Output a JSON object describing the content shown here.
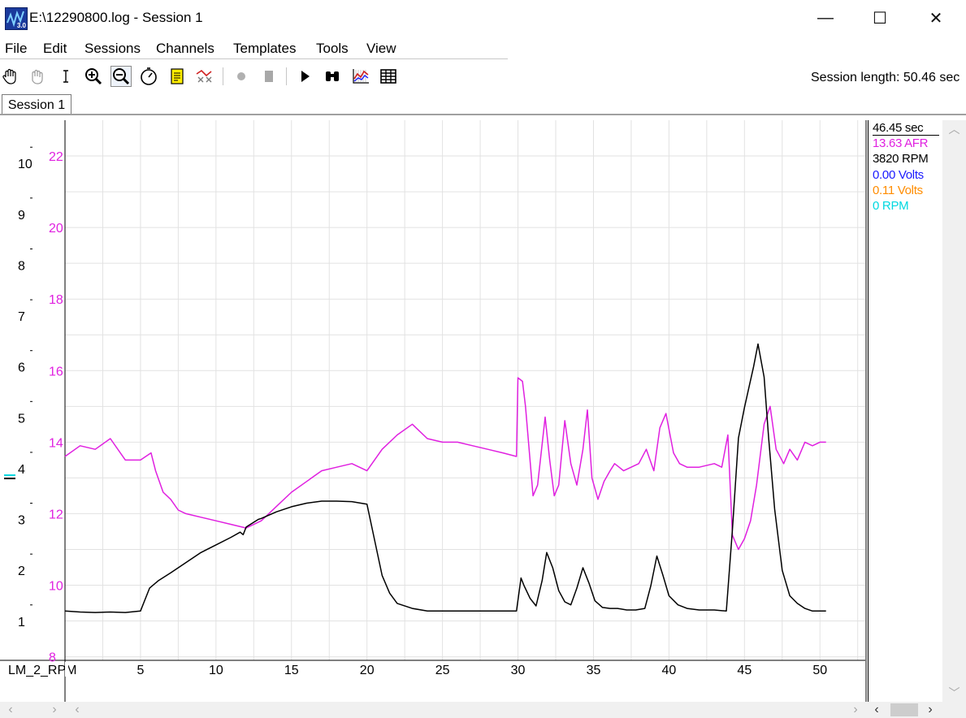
{
  "window": {
    "title": "E:\\12290800.log - Session 1",
    "icon_label": "3.0",
    "controls": {
      "minimize": "—",
      "maximize": "☐",
      "close": "✕"
    }
  },
  "menu": [
    "File",
    "Edit",
    "Sessions",
    "Channels",
    "Templates",
    "Tools",
    "View"
  ],
  "toolbar": {
    "tools": [
      "hand-icon",
      "grab-icon",
      "text-cursor-icon",
      "zoom-in-icon",
      "zoom-out-icon",
      "stopwatch-icon",
      "notes-icon",
      "zoom-fit-icon",
      "record-icon",
      "stop-icon",
      "play-icon",
      "binoculars-icon",
      "chart-icon",
      "table-icon"
    ],
    "session_length": "Session length:  50.46 sec"
  },
  "tabs": [
    "Session 1"
  ],
  "readout": {
    "time": "46.45 sec",
    "values": [
      {
        "text": "13.63 AFR",
        "color": "#e020e0"
      },
      {
        "text": "3820 RPM",
        "color": "#000000"
      },
      {
        "text": "0.00 Volts",
        "color": "#1a1aff"
      },
      {
        "text": "0.11 Volts",
        "color": "#ff8c00"
      },
      {
        "text": "0 RPM",
        "color": "#00d8e0"
      }
    ]
  },
  "chart_data": {
    "type": "line",
    "xlabel": "LM_2_RPM",
    "xlim": [
      0,
      53
    ],
    "x_ticks": [
      "5",
      "10",
      "15",
      "20",
      "25",
      "30",
      "35",
      "40",
      "45",
      "50"
    ],
    "left_axis": {
      "ticks": [
        "1",
        "2",
        "3",
        "4",
        "5",
        "6",
        "7",
        "8",
        "9",
        "10"
      ],
      "ylim": [
        0.23,
        10.85
      ],
      "color": "#000000"
    },
    "afr_axis": {
      "ticks": [
        "8",
        "10",
        "12",
        "14",
        "16",
        "18",
        "20",
        "22"
      ],
      "ylim": [
        7.9,
        23.0
      ],
      "color": "#e020e0"
    },
    "grid": true,
    "series": [
      {
        "color": "#e020e0",
        "axis": "afr",
        "x": [
          0,
          1,
          2,
          3,
          4,
          5,
          5.7,
          6,
          6.5,
          7,
          7.5,
          8,
          9,
          10,
          11,
          12,
          13,
          14,
          15,
          16,
          17,
          18,
          19,
          20,
          21,
          22,
          23,
          24,
          25,
          26,
          27,
          28,
          29,
          29.9,
          30,
          30.3,
          30.5,
          31,
          31.3,
          31.8,
          32.1,
          32.4,
          32.7,
          33.1,
          33.5,
          33.9,
          34.3,
          34.6,
          34.9,
          35.3,
          35.7,
          36.1,
          36.4,
          37,
          38,
          38.5,
          39,
          39.4,
          39.8,
          40.3,
          40.7,
          41.2,
          42,
          43,
          43.5,
          43.9,
          44.2,
          44.6,
          45,
          45.4,
          45.8,
          46.3,
          46.7,
          47.1,
          47.6,
          48,
          48.5,
          49,
          49.5,
          50,
          50.4
        ],
        "y": [
          13.6,
          13.9,
          13.8,
          14.1,
          13.5,
          13.5,
          13.7,
          13.2,
          12.6,
          12.4,
          12.1,
          12.0,
          11.9,
          11.8,
          11.7,
          11.6,
          11.8,
          12.2,
          12.6,
          12.9,
          13.2,
          13.3,
          13.4,
          13.2,
          13.8,
          14.2,
          14.5,
          14.1,
          14.0,
          14.0,
          13.9,
          13.8,
          13.7,
          13.6,
          15.8,
          15.7,
          15.0,
          12.5,
          12.8,
          14.7,
          13.5,
          12.5,
          12.8,
          14.6,
          13.4,
          12.8,
          13.8,
          14.9,
          13.0,
          12.4,
          12.9,
          13.2,
          13.4,
          13.2,
          13.4,
          13.8,
          13.2,
          14.4,
          14.8,
          13.7,
          13.4,
          13.3,
          13.3,
          13.4,
          13.3,
          14.2,
          11.4,
          11.0,
          11.3,
          11.8,
          12.8,
          14.5,
          15.0,
          13.8,
          13.4,
          13.8,
          13.5,
          14.0,
          13.9,
          14.0,
          14.0
        ]
      },
      {
        "color": "#000000",
        "axis": "left",
        "x": [
          0,
          1,
          2,
          3,
          4,
          5,
          5.6,
          6.2,
          7,
          8,
          9,
          10,
          11,
          11.6,
          11.8,
          12,
          12.8,
          13,
          14,
          15,
          16,
          17,
          18,
          19,
          20,
          20.5,
          21,
          21.5,
          22,
          23,
          24,
          25,
          26,
          27,
          28,
          29,
          29.9,
          30.2,
          30.4,
          30.8,
          31.2,
          31.6,
          31.9,
          32.3,
          32.7,
          33.1,
          33.5,
          33.9,
          34.3,
          34.7,
          35.1,
          35.6,
          36.1,
          36.6,
          37.2,
          37.8,
          38.4,
          38.8,
          39.2,
          39.6,
          40,
          40.6,
          41.2,
          42,
          43,
          43.8,
          44.2,
          44.6,
          45,
          45.3,
          45.6,
          45.9,
          46.3,
          46.6,
          47,
          47.5,
          48,
          48.5,
          49,
          49.5,
          50,
          50.4
        ],
        "y": [
          1.2,
          1.18,
          1.17,
          1.18,
          1.17,
          1.2,
          1.65,
          1.8,
          1.95,
          2.15,
          2.35,
          2.5,
          2.65,
          2.75,
          2.7,
          2.85,
          3.0,
          3.02,
          3.15,
          3.25,
          3.32,
          3.36,
          3.36,
          3.35,
          3.3,
          2.6,
          1.9,
          1.55,
          1.35,
          1.25,
          1.2,
          1.2,
          1.2,
          1.2,
          1.2,
          1.2,
          1.2,
          1.85,
          1.7,
          1.45,
          1.3,
          1.8,
          2.35,
          2.05,
          1.6,
          1.38,
          1.32,
          1.65,
          2.05,
          1.75,
          1.4,
          1.27,
          1.25,
          1.25,
          1.22,
          1.22,
          1.25,
          1.7,
          2.28,
          1.9,
          1.5,
          1.32,
          1.25,
          1.22,
          1.22,
          1.2,
          2.8,
          4.6,
          5.2,
          5.6,
          6.0,
          6.45,
          5.8,
          4.6,
          3.2,
          2.0,
          1.5,
          1.35,
          1.25,
          1.2,
          1.2,
          1.2
        ]
      }
    ],
    "cursor_marker": {
      "color": "#00d8e0",
      "left_value": 3.87
    }
  }
}
